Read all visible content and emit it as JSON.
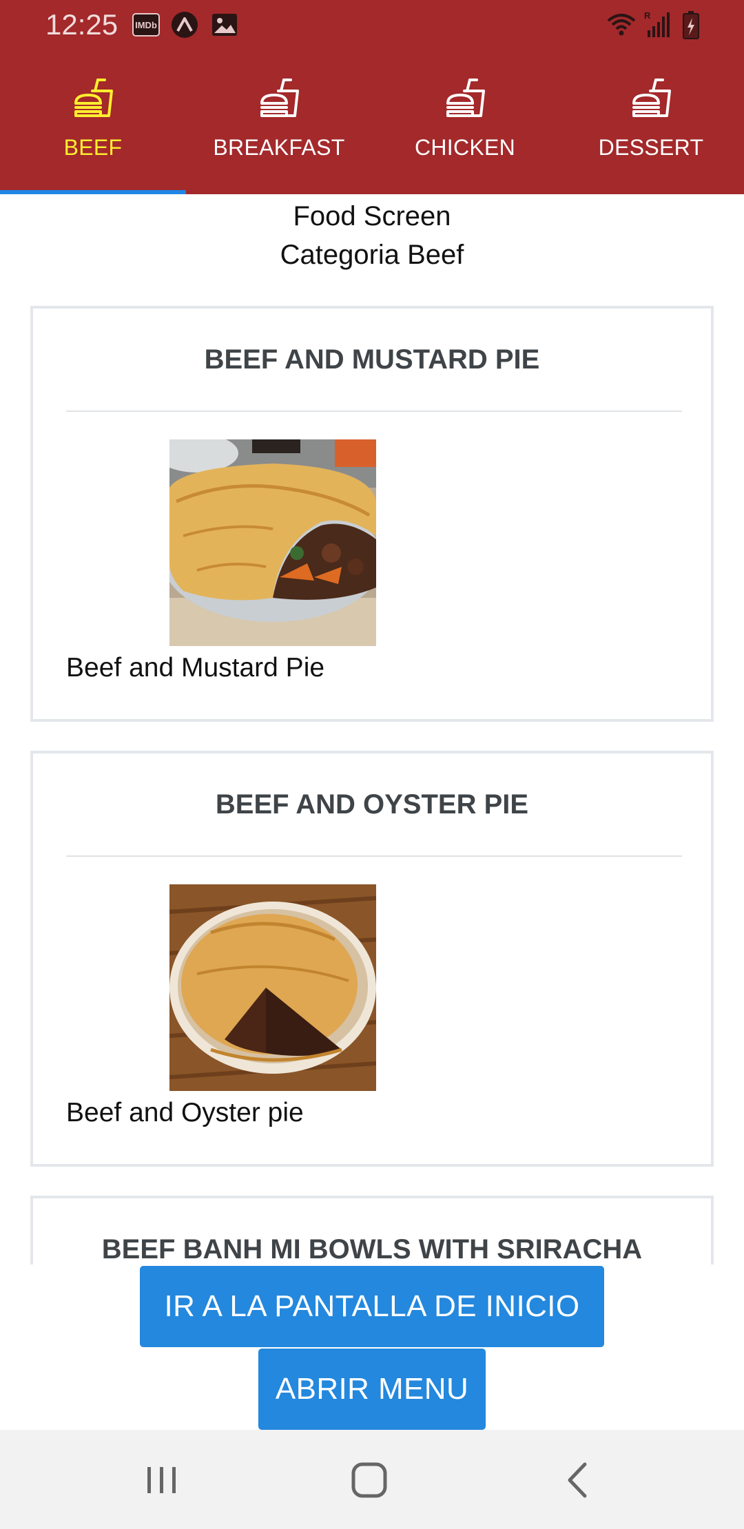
{
  "status_bar": {
    "time": "12:25",
    "left_icons": [
      "imdb-icon",
      "expo-icon",
      "gallery-icon"
    ],
    "right_icons": [
      "wifi-icon",
      "signal-roaming-icon",
      "battery-charging-icon"
    ]
  },
  "tabs": [
    {
      "label": "BEEF",
      "icon": "fastfood-icon",
      "active": true
    },
    {
      "label": "BREAKFAST",
      "icon": "fastfood-icon",
      "active": false
    },
    {
      "label": "CHICKEN",
      "icon": "fastfood-icon",
      "active": false
    },
    {
      "label": "DESSERT",
      "icon": "fastfood-icon",
      "active": false
    }
  ],
  "screen": {
    "title": "Food Screen",
    "subtitle": "Categoria Beef"
  },
  "meals": [
    {
      "title": "BEEF AND MUSTARD PIE",
      "name": "Beef and Mustard Pie"
    },
    {
      "title": "BEEF AND OYSTER PIE",
      "name": "Beef and Oyster pie"
    },
    {
      "title": "BEEF BANH MI BOWLS WITH SRIRACHA",
      "name": ""
    }
  ],
  "buttons": {
    "home": "IR A LA PANTALLA DE INICIO",
    "menu": "ABRIR MENU"
  },
  "nav": [
    "recents-icon",
    "home-icon",
    "back-icon"
  ],
  "colors": {
    "header": "#a3292b",
    "active_tab": "#ffef2e",
    "indicator": "#1f86e6",
    "button": "#2388de",
    "card_border": "#e3e6ea"
  }
}
